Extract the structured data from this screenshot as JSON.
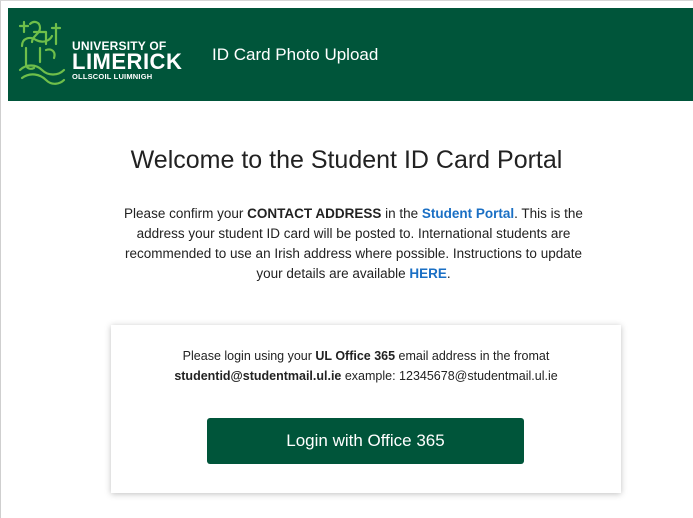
{
  "header": {
    "logo": {
      "line1": "UNIVERSITY OF",
      "line2": "LIMERICK",
      "line3": "OLLSCOIL LUIMNIGH"
    },
    "app_title": "ID Card Photo Upload",
    "background_color": "#00553a"
  },
  "main": {
    "welcome_title": "Welcome to the Student ID Card Portal",
    "notice": {
      "part1": "Please confirm your ",
      "contact_address": "CONTACT ADDRESS",
      "part2": " in the ",
      "student_portal_link": "Student Portal",
      "part3": ". This is the address your student ID card will be posted to. International students are recommended to use an Irish address where possible. Instructions to update your details are available ",
      "here_link": "HERE",
      "part4": "."
    },
    "login_card": {
      "part1": "Please login using your ",
      "ul_office": "UL Office 365",
      "part2": " email address in the fromat ",
      "format": "studentid@studentmail.ul.ie",
      "part3": " example: 12345678@studentmail.ul.ie",
      "login_button_label": "Login with Office 365"
    },
    "link_color": "#1a6fc4",
    "button_color": "#00553a"
  }
}
